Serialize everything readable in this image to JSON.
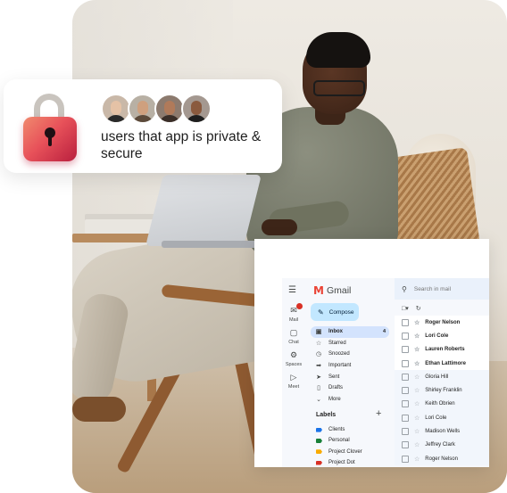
{
  "security_card": {
    "text": "users that app is private & secure",
    "lock_colors": [
      "#f08a6e",
      "#e8525a",
      "#b91f3e"
    ],
    "avatar_count": 4
  },
  "gmail": {
    "logo_text": "Gmail",
    "search_placeholder": "Search in mail",
    "compose_label": "Compose",
    "rail": [
      {
        "label": "Mail",
        "icon": "mail-icon"
      },
      {
        "label": "Chat",
        "icon": "chat-icon"
      },
      {
        "label": "Spaces",
        "icon": "spaces-icon"
      },
      {
        "label": "Meet",
        "icon": "meet-icon"
      }
    ],
    "nav": [
      {
        "label": "Inbox",
        "count": "4",
        "icon": "inbox-icon",
        "active": true
      },
      {
        "label": "Starred",
        "count": "",
        "icon": "star-icon"
      },
      {
        "label": "Snoozed",
        "count": "",
        "icon": "clock-icon"
      },
      {
        "label": "Important",
        "count": "",
        "icon": "important-icon"
      },
      {
        "label": "Sent",
        "count": "",
        "icon": "send-icon"
      },
      {
        "label": "Drafts",
        "count": "",
        "icon": "draft-icon"
      },
      {
        "label": "More",
        "count": "",
        "icon": "chevron-down-icon"
      }
    ],
    "labels_heading": "Labels",
    "labels": [
      {
        "name": "Clients",
        "color": "#1a73e8"
      },
      {
        "name": "Personal",
        "color": "#188038"
      },
      {
        "name": "Project Clover",
        "color": "#f9ab00"
      },
      {
        "name": "Project Dot",
        "color": "#d93025"
      }
    ],
    "emails": [
      {
        "from": "Roger Nelson",
        "unread": true
      },
      {
        "from": "Lori Cole",
        "unread": true
      },
      {
        "from": "Lauren Roberts",
        "unread": true
      },
      {
        "from": "Ethan Lattimore",
        "unread": true
      },
      {
        "from": "Gloria Hill",
        "unread": false
      },
      {
        "from": "Shirley Franklin",
        "unread": false
      },
      {
        "from": "Keith Obrien",
        "unread": false
      },
      {
        "from": "Lori Cole",
        "unread": false
      },
      {
        "from": "Madison Wells",
        "unread": false
      },
      {
        "from": "Jeffrey Clark",
        "unread": false
      },
      {
        "from": "Roger Nelson",
        "unread": false
      }
    ]
  }
}
